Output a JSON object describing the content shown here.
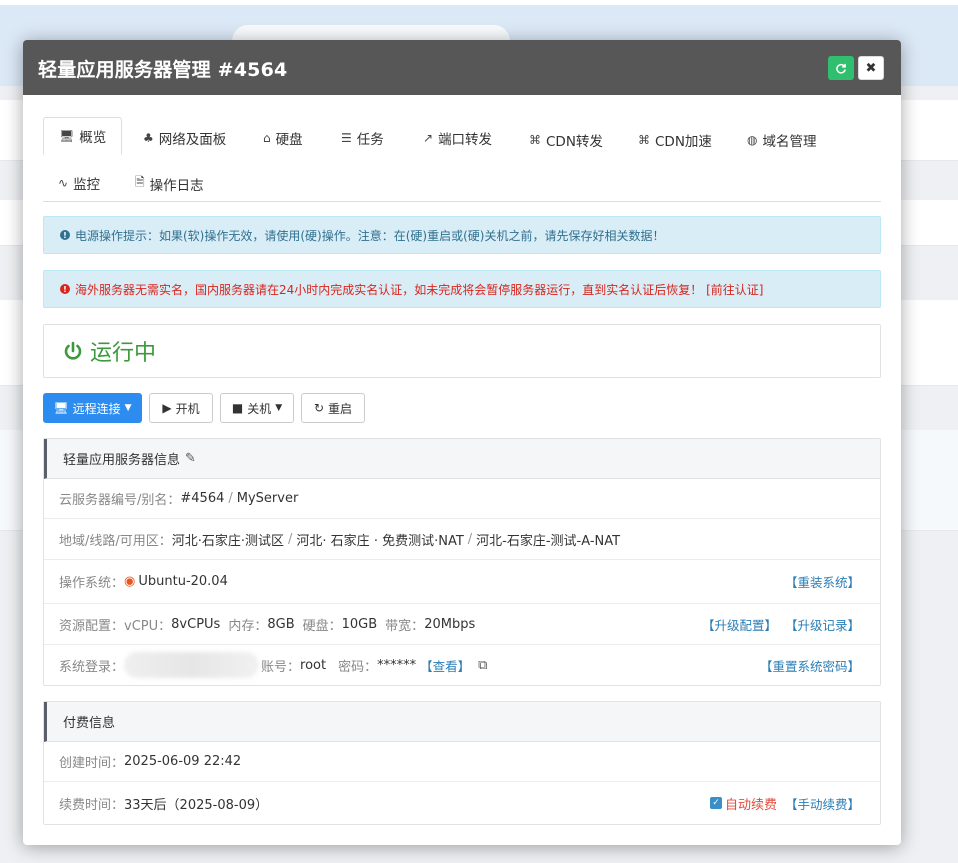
{
  "modal": {
    "title": "轻量应用服务器管理 #4564",
    "refresh_icon": "refresh-icon",
    "close_icon": "close-icon"
  },
  "tabs": [
    {
      "label": "概览",
      "icon": "desktop-icon"
    },
    {
      "label": "网络及面板",
      "icon": "sitemap-icon"
    },
    {
      "label": "硬盘",
      "icon": "hdd-icon"
    },
    {
      "label": "任务",
      "icon": "tasks-icon"
    },
    {
      "label": "端口转发",
      "icon": "external-link-icon"
    },
    {
      "label": "CDN转发",
      "icon": "command-icon"
    },
    {
      "label": "CDN加速",
      "icon": "command-icon"
    },
    {
      "label": "域名管理",
      "icon": "www-icon"
    },
    {
      "label": "监控",
      "icon": "pulse-icon"
    },
    {
      "label": "操作日志",
      "icon": "file-icon"
    }
  ],
  "alerts": {
    "power": "电源操作提示：如果(软)操作无效，请使用(硬)操作。注意：在(硬)重启或(硬)关机之前，请先保存好相关数据！",
    "realname": "海外服务器无需实名，国内服务器请在24小时内完成实名认证，如未完成将会暂停服务器运行，直到实名认证后恢复！ [前往认证]"
  },
  "status": {
    "text": "运行中",
    "color": "#3c9a3c"
  },
  "actions": {
    "remote": "远程连接",
    "start": "开机",
    "shutdown": "关机",
    "reboot": "重启"
  },
  "server_info": {
    "title": "轻量应用服务器信息",
    "id_label": "云服务器编号/别名：",
    "id_value": "#4564",
    "alias": "MyServer",
    "region_label": "地域/线路/可用区：",
    "region": "河北·石家庄·测试区",
    "line": "河北· 石家庄 · 免费测试·NAT",
    "zone": "河北-石家庄-测试-A-NAT",
    "os_label": "操作系统：",
    "os_value": "Ubuntu-20.04",
    "reinstall_link": "【重装系统】",
    "res_label": "资源配置：",
    "vcpu_label": "vCPU：",
    "vcpu": "8vCPUs",
    "mem_label": "内存：",
    "mem": "8GB",
    "disk_label": "硬盘：",
    "disk": "10GB",
    "bw_label": "带宽：",
    "bw": "20Mbps",
    "upgrade_link": "【升级配置】",
    "upgrade_record_link": "【升级记录】",
    "login_label": "系统登录：",
    "account_label": "账号：",
    "account": "root",
    "pwd_label": "密码：",
    "pwd": "******",
    "view_link": "【查看】",
    "reset_pwd_link": "【重置系统密码】"
  },
  "billing": {
    "title": "付费信息",
    "created_label": "创建时间：",
    "created": "2025-06-09 22:42",
    "renew_label": "续费时间：",
    "renew": "33天后（2025-08-09）",
    "auto_renew": "自动续费",
    "manual_renew": "【手动续费】"
  },
  "colors": {
    "accent": "#2d8cf0",
    "success": "#2fbf6f",
    "header": "#575757"
  }
}
